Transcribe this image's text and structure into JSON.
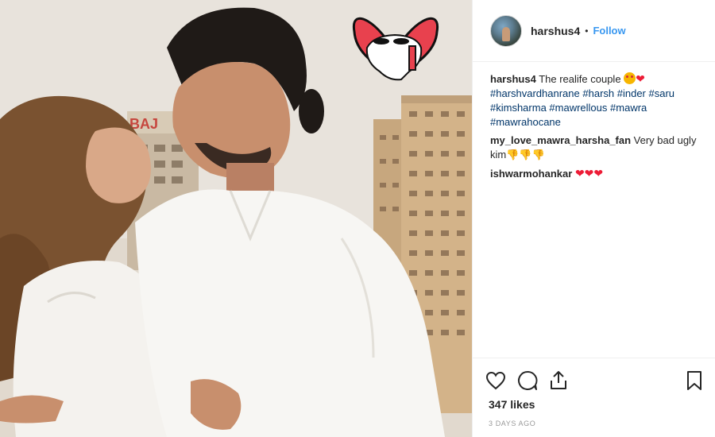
{
  "post": {
    "username": "harshus4",
    "separator": "•",
    "follow_label": "Follow",
    "likes": "347 likes",
    "date": "3 DAYS AGO"
  },
  "caption": {
    "user": "harshus4",
    "text": "The realife couple",
    "hashtags": [
      "#harshvardhanrane",
      "#harsh",
      "#inder",
      "#saru",
      "#kimsharma",
      "#mawrellous",
      "#mawra",
      "#mawrahocane"
    ]
  },
  "comments": [
    {
      "user": "my_love_mawra_harsha_fan",
      "text": "Very bad ugly kim"
    },
    {
      "user": "ishwarmohankar",
      "text": ""
    }
  ],
  "photo": {
    "sign_text": "BAJ"
  },
  "icons": {
    "like": "heart-outline-icon",
    "comment": "comment-bubble-icon",
    "share": "share-icon",
    "save": "bookmark-icon"
  },
  "colors": {
    "follow": "#3897f0",
    "hashtag": "#003569",
    "heart": "#ed1c36",
    "sticker": "#e8414e"
  }
}
